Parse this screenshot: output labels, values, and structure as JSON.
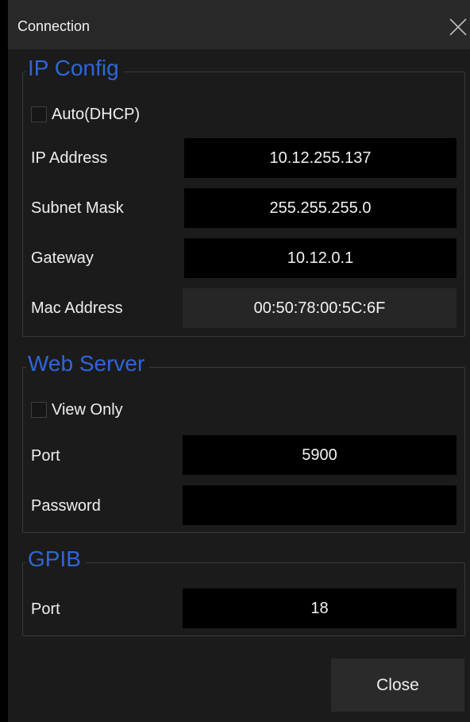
{
  "dialog": {
    "title": "Connection"
  },
  "ip_config": {
    "legend": "IP Config",
    "dhcp_label": "Auto(DHCP)",
    "dhcp_checked": false,
    "ip_address_label": "IP Address",
    "ip_address_value": "10.12.255.137",
    "subnet_mask_label": "Subnet Mask",
    "subnet_mask_value": "255.255.255.0",
    "gateway_label": "Gateway",
    "gateway_value": "10.12.0.1",
    "mac_address_label": "Mac Address",
    "mac_address_value": "00:50:78:00:5C:6F"
  },
  "web_server": {
    "legend": "Web Server",
    "view_only_label": "View Only",
    "view_only_checked": false,
    "port_label": "Port",
    "port_value": "5900",
    "password_label": "Password",
    "password_value": ""
  },
  "gpib": {
    "legend": "GPIB",
    "port_label": "Port",
    "port_value": "18"
  },
  "footer": {
    "close_label": "Close"
  },
  "colors": {
    "legend_blue": "#2f66d8",
    "background": "#1b1b1b",
    "field_bg": "#000000"
  },
  "icons": {
    "close": "close-x-icon"
  }
}
